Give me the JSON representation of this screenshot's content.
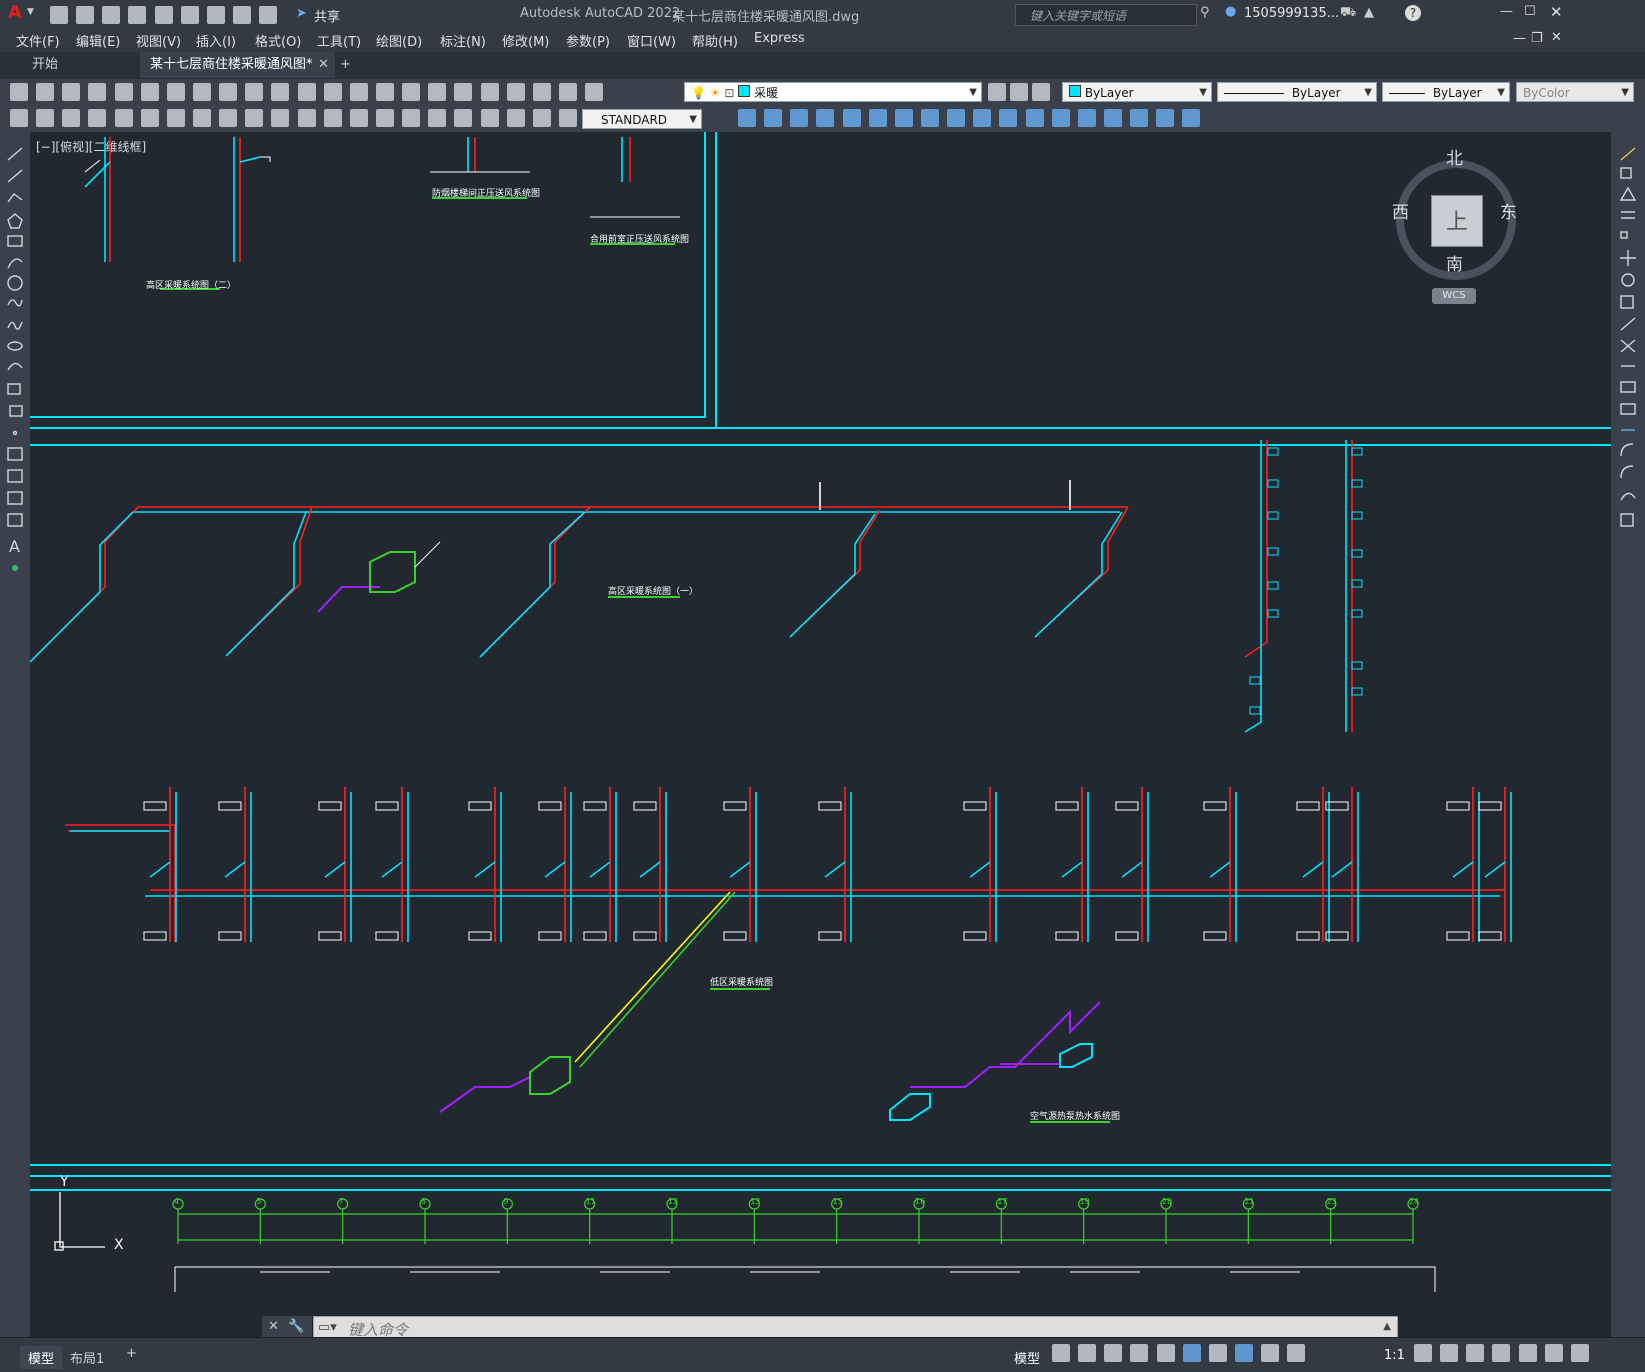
{
  "app": {
    "title": "Autodesk AutoCAD 2022",
    "file": "某十七层商住楼采暖通风图.dwg",
    "search_placeholder": "键入关键字或短语",
    "user": "1505999135...",
    "share_label": "共享"
  },
  "menu": [
    "文件(F)",
    "编辑(E)",
    "视图(V)",
    "插入(I)",
    "格式(O)",
    "工具(T)",
    "绘图(D)",
    "标注(N)",
    "修改(M)",
    "参数(P)",
    "窗口(W)",
    "帮助(H)",
    "Express"
  ],
  "tabs": [
    {
      "label": "开始"
    },
    {
      "label": "某十七层商住楼采暖通风图*"
    }
  ],
  "toolbar": {
    "layer_value": "采暖",
    "color_value": "ByLayer",
    "linetype_value": "ByLayer",
    "lineweight_value": "ByLayer",
    "plotstyle_value": "ByColor",
    "textstyle_value": "STANDARD"
  },
  "viewport": {
    "label": "[−][俯视][二维线框]",
    "viewcube_top": "上",
    "compass": {
      "north": "北",
      "south": "南",
      "east": "东",
      "west": "西"
    },
    "wcs": "WCS"
  },
  "drawing": {
    "title_high2": "高区采暖系统图（二）",
    "title_stair": "防烟楼梯间正压送风系统图",
    "title_combined": "合用前室正压送风系统图",
    "title_high1": "高区采暖系统图（一）",
    "title_low": "低区采暖系统图",
    "title_air": "空气源热泵热水系统图",
    "ucs_y": "Y",
    "ucs_x": "X",
    "axis_numbers": [
      "4",
      "5",
      "7",
      "8",
      "9",
      "11",
      "12",
      "13",
      "15",
      "16",
      "17",
      "19",
      "20",
      "21",
      "23",
      "24"
    ]
  },
  "command": {
    "placeholder": "键入命令"
  },
  "status": {
    "model_tab": "模型",
    "layout_tab": "布局1",
    "add": "+",
    "model_label": "模型",
    "scale": "1:1"
  }
}
